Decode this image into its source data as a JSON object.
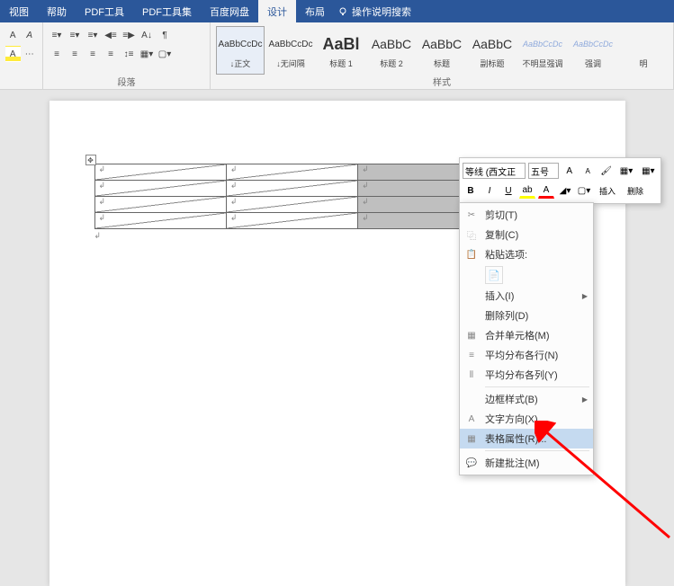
{
  "menubar": {
    "tabs": [
      "视图",
      "帮助",
      "PDF工具",
      "PDF工具集",
      "百度网盘",
      "设计",
      "布局"
    ],
    "active_index": 5,
    "search_placeholder": "操作说明搜索"
  },
  "ribbon": {
    "group_paragraph": "段落",
    "group_styles": "样式",
    "styles": [
      {
        "preview": "AaBbCcDc",
        "name": "↓正文",
        "cls": ""
      },
      {
        "preview": "AaBbCcDc",
        "name": "↓无间隔",
        "cls": ""
      },
      {
        "preview": "AaBl",
        "name": "标题 1",
        "cls": "big"
      },
      {
        "preview": "AaBbC",
        "name": "标题 2",
        "cls": "med"
      },
      {
        "preview": "AaBbC",
        "name": "标题",
        "cls": "med"
      },
      {
        "preview": "AaBbC",
        "name": "副标题",
        "cls": "med"
      },
      {
        "preview": "AaBbCcDc",
        "name": "不明显强调",
        "cls": "light"
      },
      {
        "preview": "AaBbCcDc",
        "name": "强调",
        "cls": "light"
      },
      {
        "preview": "",
        "name": "明",
        "cls": "light"
      }
    ]
  },
  "mini_toolbar": {
    "font": "等线 (西文正",
    "size": "五号",
    "btn_insert": "插入",
    "btn_delete": "删除"
  },
  "context_menu": {
    "items": [
      {
        "label": "剪切(T)",
        "icon": "scissors"
      },
      {
        "label": "复制(C)",
        "icon": "copy"
      },
      {
        "label": "粘贴选项:",
        "icon": "clipboard",
        "header": true
      },
      {
        "label": "",
        "paste_opt": true
      },
      {
        "label": "插入(I)",
        "submenu": true
      },
      {
        "label": "删除列(D)"
      },
      {
        "label": "合并单元格(M)",
        "icon": "merge"
      },
      {
        "label": "平均分布各行(N)",
        "icon": "dist-rows"
      },
      {
        "label": "平均分布各列(Y)",
        "icon": "dist-cols"
      },
      {
        "sep": true
      },
      {
        "label": "边框样式(B)",
        "submenu": true
      },
      {
        "label": "文字方向(X)...",
        "icon": "textdir"
      },
      {
        "label": "表格属性(R)...",
        "icon": "props",
        "hover": true
      },
      {
        "sep": true
      },
      {
        "label": "新建批注(M)",
        "icon": "comment"
      }
    ]
  },
  "table": {
    "rows": 4,
    "cols": 3,
    "selected_col": 2
  },
  "colors": {
    "accent": "#2b579a",
    "highlight": "#c5daf0",
    "arrow": "#ff0000"
  }
}
